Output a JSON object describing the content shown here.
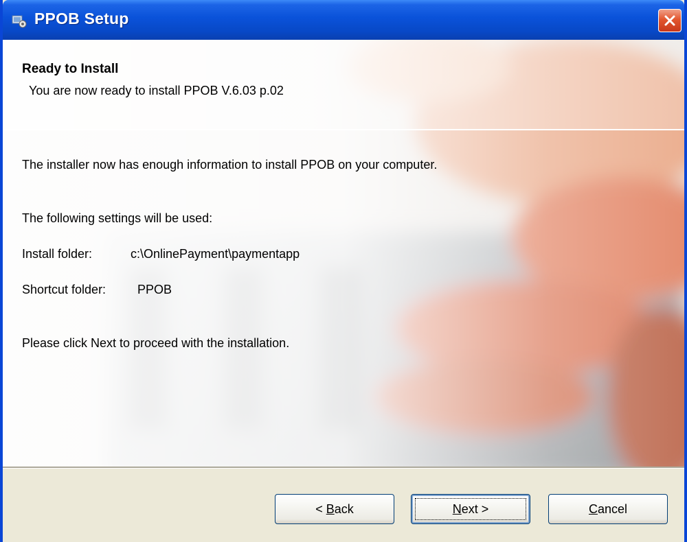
{
  "window": {
    "title": "PPOB Setup"
  },
  "header": {
    "title": "Ready to Install",
    "subtitle": "You are now ready to install PPOB V.6.03 p.02"
  },
  "content": {
    "intro": "The installer now has enough information to install PPOB on your computer.",
    "settings_heading": "The following settings will be used:",
    "install_folder_label": "Install folder:",
    "install_folder_value": "c:\\OnlinePayment\\paymentapp",
    "shortcut_folder_label": "Shortcut folder:",
    "shortcut_folder_value": "PPOB",
    "instruction": "Please click Next to proceed with the installation."
  },
  "buttons": {
    "back": {
      "prefix": "< ",
      "accel": "B",
      "rest": "ack"
    },
    "next": {
      "accel": "N",
      "rest": "ext >"
    },
    "cancel": {
      "accel": "C",
      "rest": "ancel"
    }
  },
  "icons": {
    "title": "setup-app-icon",
    "close": "close-icon"
  },
  "colors": {
    "titlebar": "#0a52d9",
    "close_button": "#e2562e",
    "dialog_bg": "#ece9d8"
  }
}
